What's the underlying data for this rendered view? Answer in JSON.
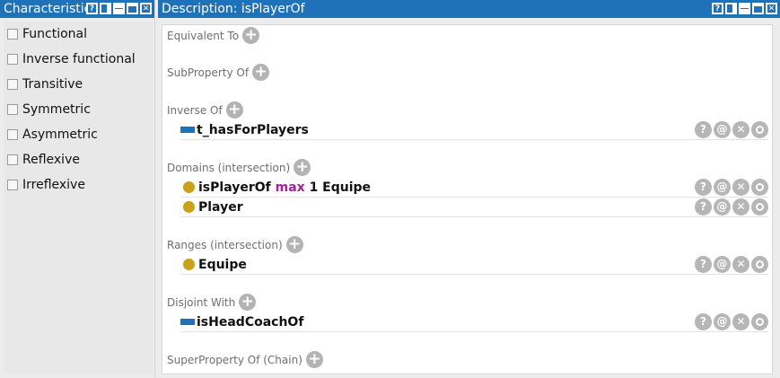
{
  "left_panel": {
    "title": "Characteristics",
    "items": [
      {
        "label": "Functional"
      },
      {
        "label": "Inverse functional"
      },
      {
        "label": "Transitive"
      },
      {
        "label": "Symmetric"
      },
      {
        "label": "Asymmetric"
      },
      {
        "label": "Reflexive"
      },
      {
        "label": "Irreflexive"
      }
    ]
  },
  "right_panel": {
    "title": "Description: isPlayerOf"
  },
  "sections": {
    "equivalent_to": {
      "label": "Equivalent To"
    },
    "subproperty_of": {
      "label": "SubProperty Of"
    },
    "inverse_of": {
      "label": "Inverse Of",
      "entries": [
        {
          "name": "t_hasForPlayers"
        }
      ]
    },
    "domains": {
      "label": "Domains (intersection)",
      "entries": [
        {
          "prop": "isPlayerOf",
          "keyword": "max",
          "rest": "1 Equipe"
        },
        {
          "name": "Player"
        }
      ]
    },
    "ranges": {
      "label": "Ranges (intersection)",
      "entries": [
        {
          "name": "Equipe"
        }
      ]
    },
    "disjoint_with": {
      "label": "Disjoint With",
      "entries": [
        {
          "name": "isHeadCoachOf"
        }
      ]
    },
    "superproperty_chain": {
      "label": "SuperProperty Of (Chain)"
    }
  },
  "icons": {
    "add": "+",
    "help": "?",
    "annotate": "@",
    "delete": "✕",
    "edit": "ring"
  },
  "colors": {
    "titlebar": "#1f71b8",
    "object_property": "#1f71b8",
    "class": "#c9a21c",
    "keyword": "#9b2393"
  }
}
